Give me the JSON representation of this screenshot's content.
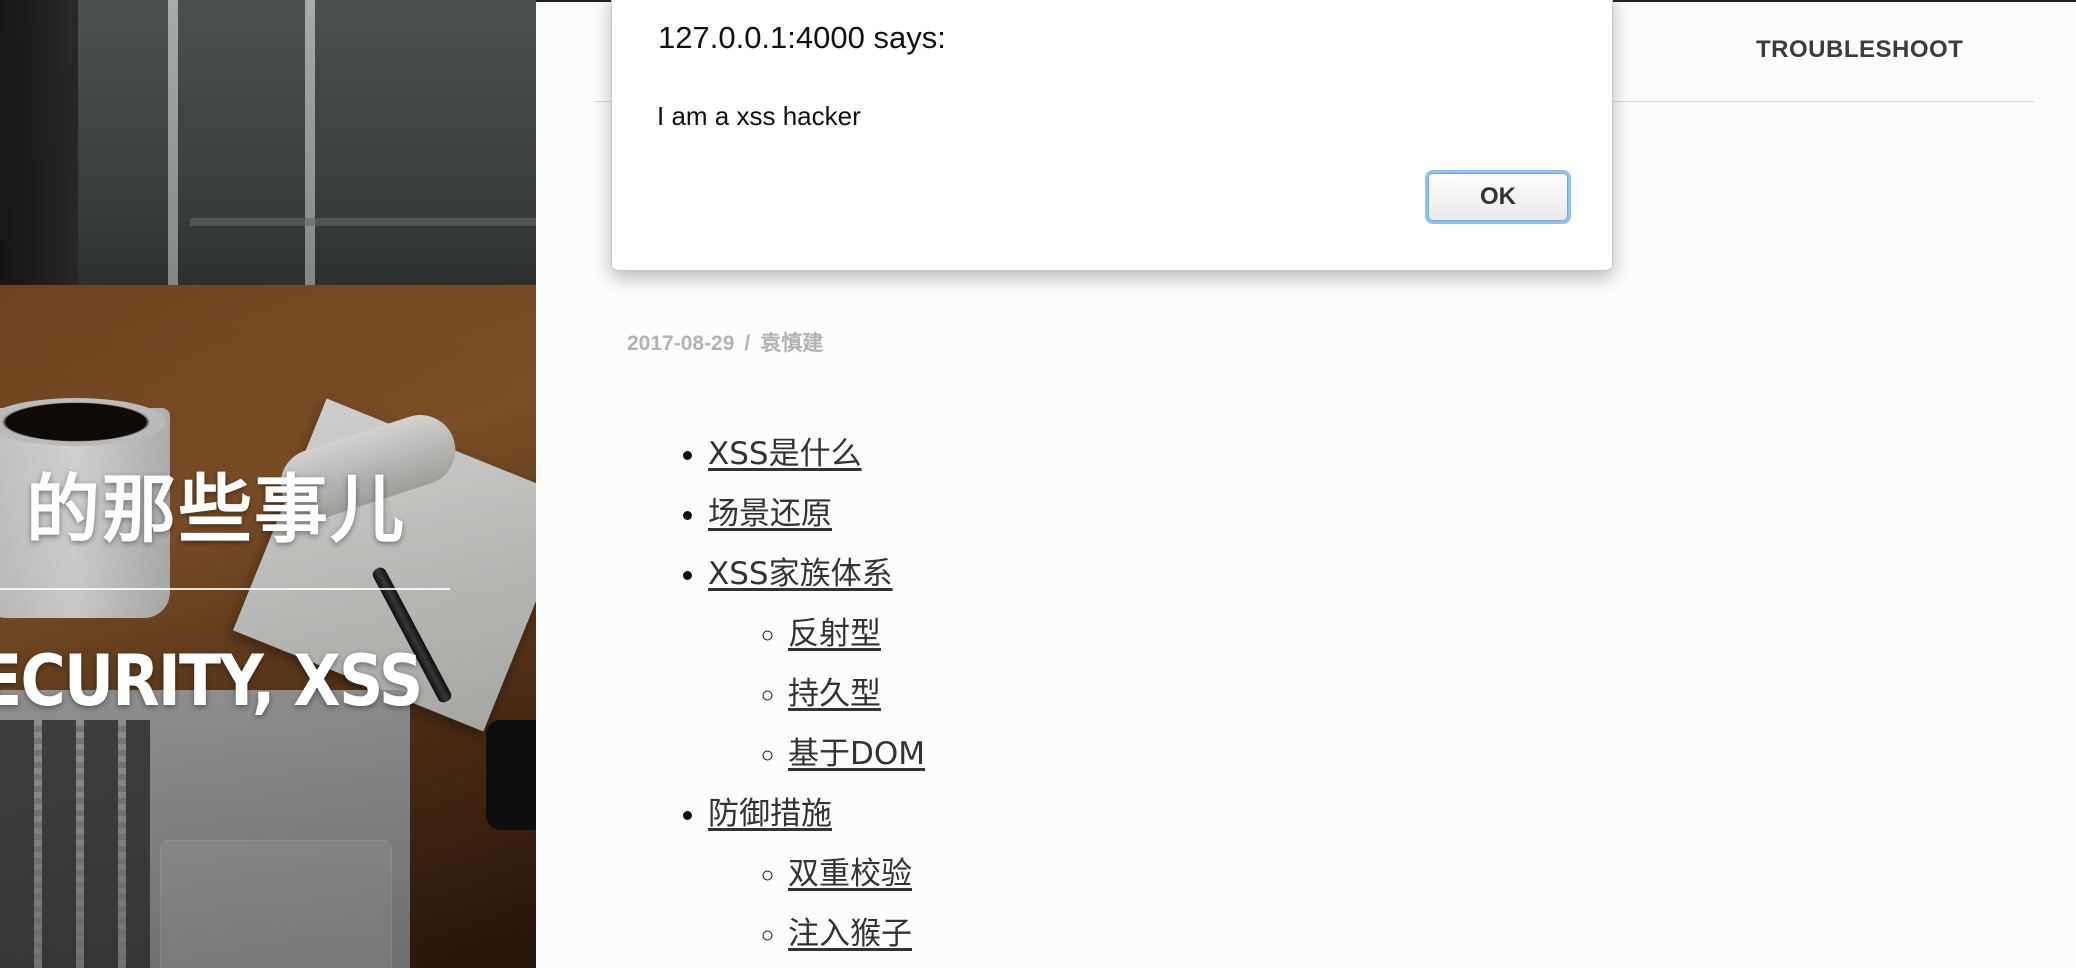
{
  "hero": {
    "title": "的那些事儿",
    "tags": "ECURITY, XSS"
  },
  "nav": {
    "troubleshoot": "TROUBLESHOOT"
  },
  "post": {
    "date": "2017-08-29",
    "separator": "/",
    "author": "袁慎建"
  },
  "toc": {
    "items": [
      {
        "label": "XSS是什么"
      },
      {
        "label": "场景还原"
      },
      {
        "label": "XSS家族体系",
        "children": [
          "反射型",
          "持久型",
          "基于DOM"
        ]
      },
      {
        "label": "防御措施",
        "children": [
          "双重校验",
          "注入猴子"
        ]
      }
    ]
  },
  "dialog": {
    "title": "127.0.0.1:4000 says:",
    "message": "I am a xss hacker",
    "ok_label": "OK"
  }
}
